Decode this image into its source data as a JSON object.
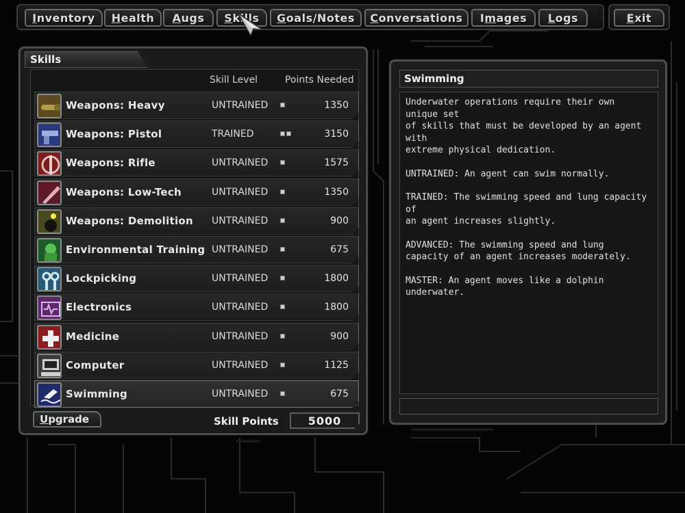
{
  "nav": {
    "items": [
      {
        "label": "Inventory",
        "hotkey": "I",
        "rest": "nventory"
      },
      {
        "label": "Health",
        "hotkey": "H",
        "rest": "ealth"
      },
      {
        "label": "Augs",
        "hotkey": "A",
        "rest": "ugs"
      },
      {
        "label": "Skills",
        "hotkey": "S",
        "rest": "kills"
      },
      {
        "label": "Goals/Notes",
        "hotkey": "G",
        "rest": "oals/Notes"
      },
      {
        "label": "Conversations",
        "hotkey": "C",
        "rest": "onversations"
      },
      {
        "label": "Images",
        "hotkey": "m",
        "pre": "I",
        "rest": "ages"
      },
      {
        "label": "Logs",
        "hotkey": "L",
        "rest": "ogs"
      }
    ],
    "exit": {
      "label": "Exit",
      "hotkey": "E",
      "rest": "xit"
    }
  },
  "skills_panel": {
    "title": "Skills",
    "col_level": "Skill Level",
    "col_points": "Points Needed",
    "skills": [
      {
        "name": "Weapons: Heavy",
        "level": "UNTRAINED",
        "pips": 1,
        "points": "1350",
        "icon": "heavy-weapon-icon"
      },
      {
        "name": "Weapons: Pistol",
        "level": "TRAINED",
        "pips": 2,
        "points": "3150",
        "icon": "pistol-icon"
      },
      {
        "name": "Weapons: Rifle",
        "level": "UNTRAINED",
        "pips": 1,
        "points": "1575",
        "icon": "rifle-icon"
      },
      {
        "name": "Weapons: Low-Tech",
        "level": "UNTRAINED",
        "pips": 1,
        "points": "1350",
        "icon": "knife-icon"
      },
      {
        "name": "Weapons: Demolition",
        "level": "UNTRAINED",
        "pips": 1,
        "points": "900",
        "icon": "bomb-icon"
      },
      {
        "name": "Environmental Training",
        "level": "UNTRAINED",
        "pips": 1,
        "points": "675",
        "icon": "hazmat-icon"
      },
      {
        "name": "Lockpicking",
        "level": "UNTRAINED",
        "pips": 1,
        "points": "1800",
        "icon": "lockpick-icon"
      },
      {
        "name": "Electronics",
        "level": "UNTRAINED",
        "pips": 1,
        "points": "1800",
        "icon": "circuit-icon"
      },
      {
        "name": "Medicine",
        "level": "UNTRAINED",
        "pips": 1,
        "points": "900",
        "icon": "medkit-icon"
      },
      {
        "name": "Computer",
        "level": "UNTRAINED",
        "pips": 1,
        "points": "1125",
        "icon": "computer-icon"
      },
      {
        "name": "Swimming",
        "level": "UNTRAINED",
        "pips": 1,
        "points": "675",
        "icon": "swimmer-icon"
      }
    ],
    "selected_index": 10,
    "upgrade": {
      "hotkey": "U",
      "rest": "pgrade"
    },
    "skill_points_label": "Skill Points",
    "skill_points_value": "5000"
  },
  "description": {
    "title": "Swimming",
    "paragraphs": [
      "Underwater operations require their own unique set\nof skills that must be developed by an agent with\nextreme physical dedication.",
      "UNTRAINED: An agent can swim normally.",
      "TRAINED: The swimming speed and lung capacity of\nan agent increases slightly.",
      "ADVANCED:  The swimming speed and lung\ncapacity of an agent increases moderately.",
      "MASTER: An agent moves like a dolphin\nunderwater."
    ]
  }
}
